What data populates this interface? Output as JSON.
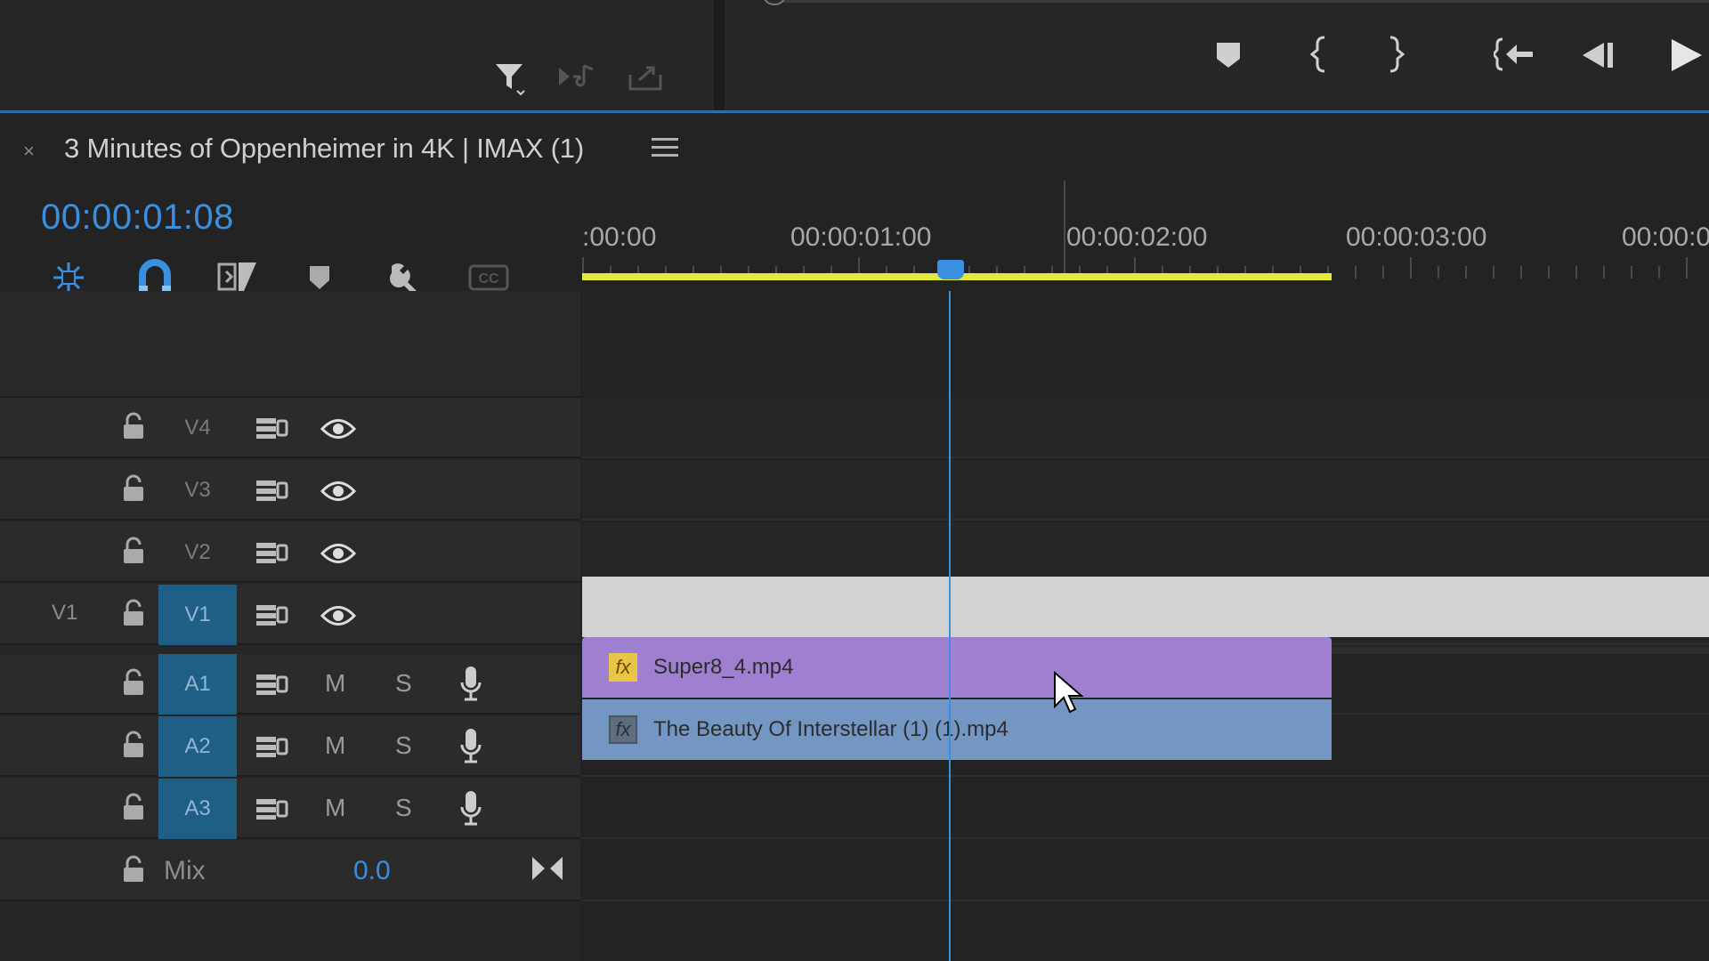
{
  "top_toolbar": {
    "left_icons": [
      "filter-icon",
      "insert-audio-icon",
      "export-icon"
    ],
    "right_icons": [
      "add-marker-icon",
      "mark-in-icon",
      "mark-out-icon",
      "go-to-in-icon",
      "step-back-icon",
      "play-icon"
    ]
  },
  "sequence": {
    "tab_label": "3 Minutes of Oppenheimer in 4K  |  IMAX (1)",
    "close_glyph": "×",
    "timecode": "00:00:01:08"
  },
  "header_tools": [
    "snap-in-nested-icon",
    "linked-selection-icon",
    "linked-clips-icon",
    "add-marker-icon",
    "settings-wrench-icon",
    "captions-icon"
  ],
  "ruler": {
    "labels": [
      ":00:00",
      "00:00:01:00",
      "00:00:02:00",
      "00:00:03:00",
      "00:00:0"
    ]
  },
  "tracks": {
    "video": [
      {
        "name": "V4",
        "source": "",
        "targeted": false
      },
      {
        "name": "V3",
        "source": "",
        "targeted": false
      },
      {
        "name": "V2",
        "source": "",
        "targeted": false
      },
      {
        "name": "V1",
        "source": "V1",
        "targeted": true
      }
    ],
    "audio": [
      {
        "name": "A1",
        "m": "M",
        "s": "S",
        "targeted": true
      },
      {
        "name": "A2",
        "m": "M",
        "s": "S",
        "targeted": true
      },
      {
        "name": "A3",
        "m": "M",
        "s": "S",
        "targeted": true
      }
    ],
    "mix": {
      "label": "Mix",
      "value": "0.0"
    }
  },
  "clips": {
    "super8": {
      "fx": "fx",
      "name": "Super8_4.mp4"
    },
    "interstellar": {
      "fx": "fx",
      "name": "The Beauty Of Interstellar (1) (1).mp4"
    }
  },
  "colors": {
    "accent_blue": "#3b8fe0",
    "work_area": "#e6e83a",
    "clip_purple": "#9e7fd0",
    "clip_blue": "#7396c2"
  }
}
